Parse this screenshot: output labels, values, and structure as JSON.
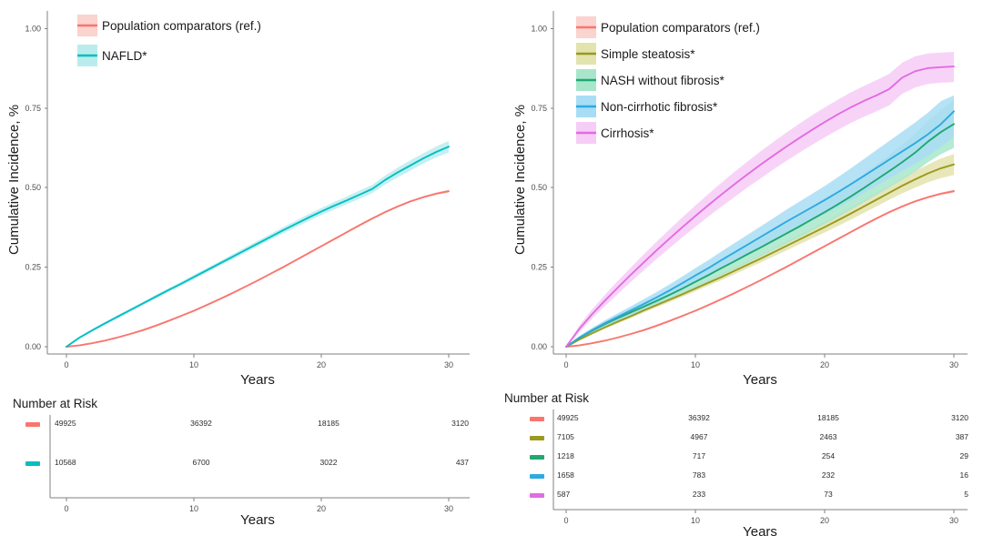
{
  "figure": {
    "panels": [
      {
        "id": "panel-left",
        "axis": {
          "xlabel": "Years",
          "ylabel": "Cumulative Incidence, %",
          "xticks": [
            0,
            10,
            20,
            30
          ],
          "xtick_labels": [
            "0",
            "10",
            "20",
            "30"
          ],
          "yticks": [
            0.0,
            0.25,
            0.5,
            0.75,
            1.0
          ],
          "ytick_labels": [
            "0.00",
            "0.25",
            "0.50",
            "0.75",
            "1.00"
          ],
          "xlim": [
            0,
            31.5
          ],
          "ylim": [
            0,
            1.05
          ]
        },
        "legend": [
          {
            "label": "Population comparators (ref.)",
            "color": "#f8766d",
            "band": "#fbd3cf"
          },
          {
            "label": "NAFLD*",
            "color": "#00bfc4",
            "band": "#bbeced"
          }
        ],
        "risk_table": {
          "title": "Number at Risk",
          "columns": [
            "0",
            "10",
            "20",
            "30"
          ],
          "xlabel": "Years",
          "rows": [
            {
              "color": "#f8766d",
              "values": [
                "49925",
                "36392",
                "18185",
                "3120"
              ]
            },
            {
              "color": "#00bfc4",
              "values": [
                "10568",
                "6700",
                "3022",
                "437"
              ]
            }
          ]
        }
      },
      {
        "id": "panel-right",
        "axis": {
          "xlabel": "Years",
          "ylabel": "Cumulative Incidence, %",
          "xticks": [
            0,
            10,
            20,
            30
          ],
          "xtick_labels": [
            "0",
            "10",
            "20",
            "30"
          ],
          "yticks": [
            0.0,
            0.25,
            0.5,
            0.75,
            1.0
          ],
          "ytick_labels": [
            "0.00",
            "0.25",
            "0.50",
            "0.75",
            "1.00"
          ],
          "xlim": [
            0,
            31.5
          ],
          "ylim": [
            0,
            1.05
          ]
        },
        "legend": [
          {
            "label": "Population comparators (ref.)",
            "color": "#f8766d",
            "band": "#fbd3cf"
          },
          {
            "label": "Simple steatosis*",
            "color": "#9a9a1f",
            "band": "#e3e3ae"
          },
          {
            "label": "NASH without fibrosis*",
            "color": "#1fa871",
            "band": "#a8e6cb"
          },
          {
            "label": "Non-cirrhotic fibrosis*",
            "color": "#2eaae0",
            "band": "#a9ddf5"
          },
          {
            "label": "Cirrhosis*",
            "color": "#e36be3",
            "band": "#f6cdf6"
          }
        ],
        "risk_table": {
          "title": "Number at Risk",
          "columns": [
            "0",
            "10",
            "20",
            "30"
          ],
          "xlabel": "Years",
          "rows": [
            {
              "color": "#f8766d",
              "values": [
                "49925",
                "36392",
                "18185",
                "3120"
              ]
            },
            {
              "color": "#9a9a1f",
              "values": [
                "7105",
                "4967",
                "2463",
                "387"
              ]
            },
            {
              "color": "#1fa871",
              "values": [
                "1218",
                "717",
                "254",
                "29"
              ]
            },
            {
              "color": "#2eaae0",
              "values": [
                "1658",
                "783",
                "232",
                "16"
              ]
            },
            {
              "color": "#e36be3",
              "values": [
                "587",
                "233",
                "73",
                "5"
              ]
            }
          ]
        }
      }
    ]
  },
  "chart_data": [
    {
      "type": "line",
      "title": "",
      "xlabel": "Years",
      "ylabel": "Cumulative Incidence, %",
      "xlim": [
        0,
        31.5
      ],
      "ylim": [
        0,
        1.05
      ],
      "xticks": [
        0,
        10,
        20,
        30
      ],
      "yticks": [
        0.0,
        0.25,
        0.5,
        0.75,
        1.0
      ],
      "grid": false,
      "legend_position": "top-left",
      "x": [
        0,
        1,
        2,
        3,
        4,
        5,
        6,
        7,
        8,
        9,
        10,
        11,
        12,
        13,
        14,
        15,
        16,
        17,
        18,
        19,
        20,
        21,
        22,
        23,
        24,
        25,
        26,
        27,
        28,
        29,
        30
      ],
      "series": [
        {
          "name": "Population comparators (ref.)",
          "color": "#f8766d",
          "values": [
            0.0,
            0.004,
            0.011,
            0.019,
            0.029,
            0.04,
            0.052,
            0.066,
            0.081,
            0.097,
            0.113,
            0.131,
            0.149,
            0.168,
            0.188,
            0.208,
            0.229,
            0.25,
            0.272,
            0.294,
            0.316,
            0.338,
            0.36,
            0.382,
            0.403,
            0.423,
            0.441,
            0.457,
            0.47,
            0.481,
            0.489
          ],
          "ci_lower": [
            0.0,
            0.003,
            0.01,
            0.018,
            0.028,
            0.039,
            0.051,
            0.065,
            0.08,
            0.096,
            0.112,
            0.13,
            0.148,
            0.167,
            0.187,
            0.207,
            0.228,
            0.249,
            0.271,
            0.293,
            0.315,
            0.337,
            0.358,
            0.38,
            0.401,
            0.421,
            0.438,
            0.454,
            0.467,
            0.477,
            0.484
          ],
          "ci_upper": [
            0.0,
            0.005,
            0.012,
            0.02,
            0.03,
            0.041,
            0.053,
            0.067,
            0.082,
            0.098,
            0.114,
            0.132,
            0.15,
            0.169,
            0.189,
            0.209,
            0.23,
            0.251,
            0.273,
            0.295,
            0.317,
            0.339,
            0.362,
            0.384,
            0.405,
            0.425,
            0.444,
            0.46,
            0.473,
            0.485,
            0.494
          ]
        },
        {
          "name": "NAFLD*",
          "color": "#00bfc4",
          "values": [
            0.0,
            0.028,
            0.051,
            0.073,
            0.094,
            0.115,
            0.136,
            0.157,
            0.178,
            0.198,
            0.219,
            0.24,
            0.261,
            0.282,
            0.303,
            0.324,
            0.345,
            0.366,
            0.386,
            0.406,
            0.425,
            0.443,
            0.46,
            0.478,
            0.496,
            0.524,
            0.548,
            0.57,
            0.592,
            0.612,
            0.629
          ],
          "ci_lower": [
            0.0,
            0.025,
            0.047,
            0.069,
            0.089,
            0.11,
            0.131,
            0.151,
            0.172,
            0.192,
            0.212,
            0.233,
            0.254,
            0.274,
            0.295,
            0.315,
            0.336,
            0.356,
            0.376,
            0.395,
            0.414,
            0.431,
            0.448,
            0.465,
            0.483,
            0.51,
            0.533,
            0.554,
            0.576,
            0.595,
            0.611
          ],
          "ci_upper": [
            0.0,
            0.031,
            0.055,
            0.077,
            0.099,
            0.12,
            0.141,
            0.163,
            0.184,
            0.204,
            0.226,
            0.247,
            0.268,
            0.29,
            0.311,
            0.333,
            0.354,
            0.376,
            0.396,
            0.417,
            0.436,
            0.455,
            0.472,
            0.491,
            0.509,
            0.538,
            0.563,
            0.586,
            0.608,
            0.629,
            0.647
          ]
        }
      ]
    },
    {
      "type": "line",
      "title": "",
      "xlabel": "Years",
      "ylabel": "Cumulative Incidence, %",
      "xlim": [
        0,
        31.5
      ],
      "ylim": [
        0,
        1.05
      ],
      "xticks": [
        0,
        10,
        20,
        30
      ],
      "yticks": [
        0.0,
        0.25,
        0.5,
        0.75,
        1.0
      ],
      "grid": false,
      "legend_position": "top-left",
      "x": [
        0,
        1,
        2,
        3,
        4,
        5,
        6,
        7,
        8,
        9,
        10,
        11,
        12,
        13,
        14,
        15,
        16,
        17,
        18,
        19,
        20,
        21,
        22,
        23,
        24,
        25,
        26,
        27,
        28,
        29,
        30
      ],
      "series": [
        {
          "name": "Population comparators (ref.)",
          "color": "#f8766d",
          "values": [
            0.0,
            0.004,
            0.011,
            0.019,
            0.029,
            0.04,
            0.052,
            0.066,
            0.081,
            0.097,
            0.113,
            0.131,
            0.149,
            0.168,
            0.188,
            0.208,
            0.229,
            0.25,
            0.272,
            0.294,
            0.316,
            0.338,
            0.36,
            0.382,
            0.403,
            0.423,
            0.441,
            0.457,
            0.47,
            0.481,
            0.489
          ],
          "ci_lower": [
            0.0,
            0.003,
            0.01,
            0.018,
            0.028,
            0.039,
            0.051,
            0.065,
            0.08,
            0.096,
            0.112,
            0.13,
            0.148,
            0.167,
            0.187,
            0.207,
            0.228,
            0.249,
            0.271,
            0.293,
            0.315,
            0.337,
            0.358,
            0.38,
            0.401,
            0.421,
            0.438,
            0.454,
            0.467,
            0.477,
            0.484
          ],
          "ci_upper": [
            0.0,
            0.005,
            0.012,
            0.02,
            0.03,
            0.041,
            0.053,
            0.067,
            0.082,
            0.098,
            0.114,
            0.132,
            0.15,
            0.169,
            0.189,
            0.209,
            0.23,
            0.251,
            0.273,
            0.295,
            0.317,
            0.339,
            0.362,
            0.384,
            0.405,
            0.425,
            0.444,
            0.46,
            0.473,
            0.485,
            0.494
          ]
        },
        {
          "name": "Simple steatosis*",
          "color": "#9a9a1f",
          "values": [
            0.0,
            0.022,
            0.042,
            0.061,
            0.079,
            0.096,
            0.114,
            0.131,
            0.148,
            0.165,
            0.183,
            0.201,
            0.219,
            0.238,
            0.257,
            0.276,
            0.296,
            0.316,
            0.336,
            0.356,
            0.376,
            0.397,
            0.418,
            0.44,
            0.462,
            0.484,
            0.506,
            0.526,
            0.545,
            0.561,
            0.573
          ],
          "ci_lower": [
            0.0,
            0.019,
            0.038,
            0.056,
            0.073,
            0.09,
            0.107,
            0.124,
            0.14,
            0.157,
            0.174,
            0.192,
            0.209,
            0.227,
            0.246,
            0.264,
            0.283,
            0.302,
            0.321,
            0.34,
            0.359,
            0.379,
            0.399,
            0.42,
            0.441,
            0.462,
            0.482,
            0.5,
            0.517,
            0.53,
            0.54
          ],
          "ci_upper": [
            0.0,
            0.025,
            0.046,
            0.066,
            0.085,
            0.102,
            0.121,
            0.138,
            0.156,
            0.173,
            0.192,
            0.21,
            0.229,
            0.249,
            0.268,
            0.288,
            0.309,
            0.33,
            0.351,
            0.372,
            0.393,
            0.415,
            0.437,
            0.46,
            0.483,
            0.506,
            0.53,
            0.552,
            0.573,
            0.592,
            0.606
          ]
        },
        {
          "name": "NASH without fibrosis*",
          "color": "#1fa871",
          "values": [
            0.0,
            0.027,
            0.05,
            0.071,
            0.09,
            0.108,
            0.126,
            0.144,
            0.163,
            0.183,
            0.204,
            0.225,
            0.247,
            0.268,
            0.29,
            0.311,
            0.333,
            0.355,
            0.377,
            0.4,
            0.423,
            0.447,
            0.472,
            0.498,
            0.525,
            0.552,
            0.58,
            0.61,
            0.645,
            0.675,
            0.7
          ],
          "ci_lower": [
            0.0,
            0.022,
            0.043,
            0.062,
            0.079,
            0.096,
            0.112,
            0.129,
            0.146,
            0.165,
            0.184,
            0.204,
            0.224,
            0.243,
            0.263,
            0.283,
            0.303,
            0.323,
            0.343,
            0.364,
            0.385,
            0.407,
            0.43,
            0.453,
            0.477,
            0.501,
            0.525,
            0.55,
            0.58,
            0.605,
            0.625
          ],
          "ci_upper": [
            0.0,
            0.032,
            0.057,
            0.08,
            0.101,
            0.12,
            0.14,
            0.159,
            0.18,
            0.201,
            0.224,
            0.246,
            0.27,
            0.293,
            0.317,
            0.339,
            0.363,
            0.387,
            0.411,
            0.436,
            0.461,
            0.487,
            0.514,
            0.543,
            0.573,
            0.603,
            0.635,
            0.67,
            0.71,
            0.745,
            0.775
          ]
        },
        {
          "name": "Non-cirrhotic fibrosis*",
          "color": "#2eaae0",
          "values": [
            0.0,
            0.028,
            0.052,
            0.074,
            0.094,
            0.114,
            0.134,
            0.155,
            0.177,
            0.2,
            0.224,
            0.247,
            0.272,
            0.296,
            0.32,
            0.344,
            0.368,
            0.392,
            0.415,
            0.438,
            0.461,
            0.485,
            0.51,
            0.536,
            0.562,
            0.588,
            0.614,
            0.64,
            0.668,
            0.7,
            0.74
          ],
          "ci_lower": [
            0.0,
            0.023,
            0.045,
            0.065,
            0.083,
            0.101,
            0.119,
            0.138,
            0.158,
            0.179,
            0.201,
            0.222,
            0.245,
            0.267,
            0.289,
            0.311,
            0.333,
            0.354,
            0.375,
            0.396,
            0.417,
            0.438,
            0.46,
            0.483,
            0.506,
            0.529,
            0.552,
            0.575,
            0.6,
            0.628,
            0.66
          ],
          "ci_upper": [
            0.0,
            0.033,
            0.059,
            0.083,
            0.105,
            0.127,
            0.149,
            0.172,
            0.196,
            0.221,
            0.247,
            0.272,
            0.299,
            0.325,
            0.351,
            0.377,
            0.403,
            0.43,
            0.455,
            0.48,
            0.505,
            0.532,
            0.56,
            0.589,
            0.618,
            0.647,
            0.676,
            0.705,
            0.736,
            0.772,
            0.79
          ]
        },
        {
          "name": "Cirrhosis*",
          "color": "#e36be3",
          "values": [
            0.0,
            0.055,
            0.102,
            0.145,
            0.186,
            0.226,
            0.265,
            0.303,
            0.34,
            0.376,
            0.411,
            0.445,
            0.478,
            0.51,
            0.541,
            0.571,
            0.6,
            0.628,
            0.655,
            0.681,
            0.706,
            0.73,
            0.752,
            0.772,
            0.79,
            0.81,
            0.846,
            0.866,
            0.876,
            0.879,
            0.881
          ],
          "ci_lower": [
            0.0,
            0.045,
            0.088,
            0.128,
            0.166,
            0.204,
            0.24,
            0.276,
            0.31,
            0.344,
            0.377,
            0.409,
            0.44,
            0.47,
            0.5,
            0.528,
            0.556,
            0.583,
            0.609,
            0.634,
            0.658,
            0.681,
            0.703,
            0.722,
            0.74,
            0.759,
            0.795,
            0.815,
            0.826,
            0.83,
            0.832
          ],
          "ci_upper": [
            0.0,
            0.066,
            0.117,
            0.163,
            0.207,
            0.249,
            0.29,
            0.33,
            0.369,
            0.407,
            0.444,
            0.48,
            0.515,
            0.549,
            0.581,
            0.613,
            0.643,
            0.672,
            0.7,
            0.727,
            0.752,
            0.776,
            0.799,
            0.819,
            0.838,
            0.858,
            0.893,
            0.913,
            0.922,
            0.925,
            0.927
          ]
        }
      ]
    }
  ]
}
